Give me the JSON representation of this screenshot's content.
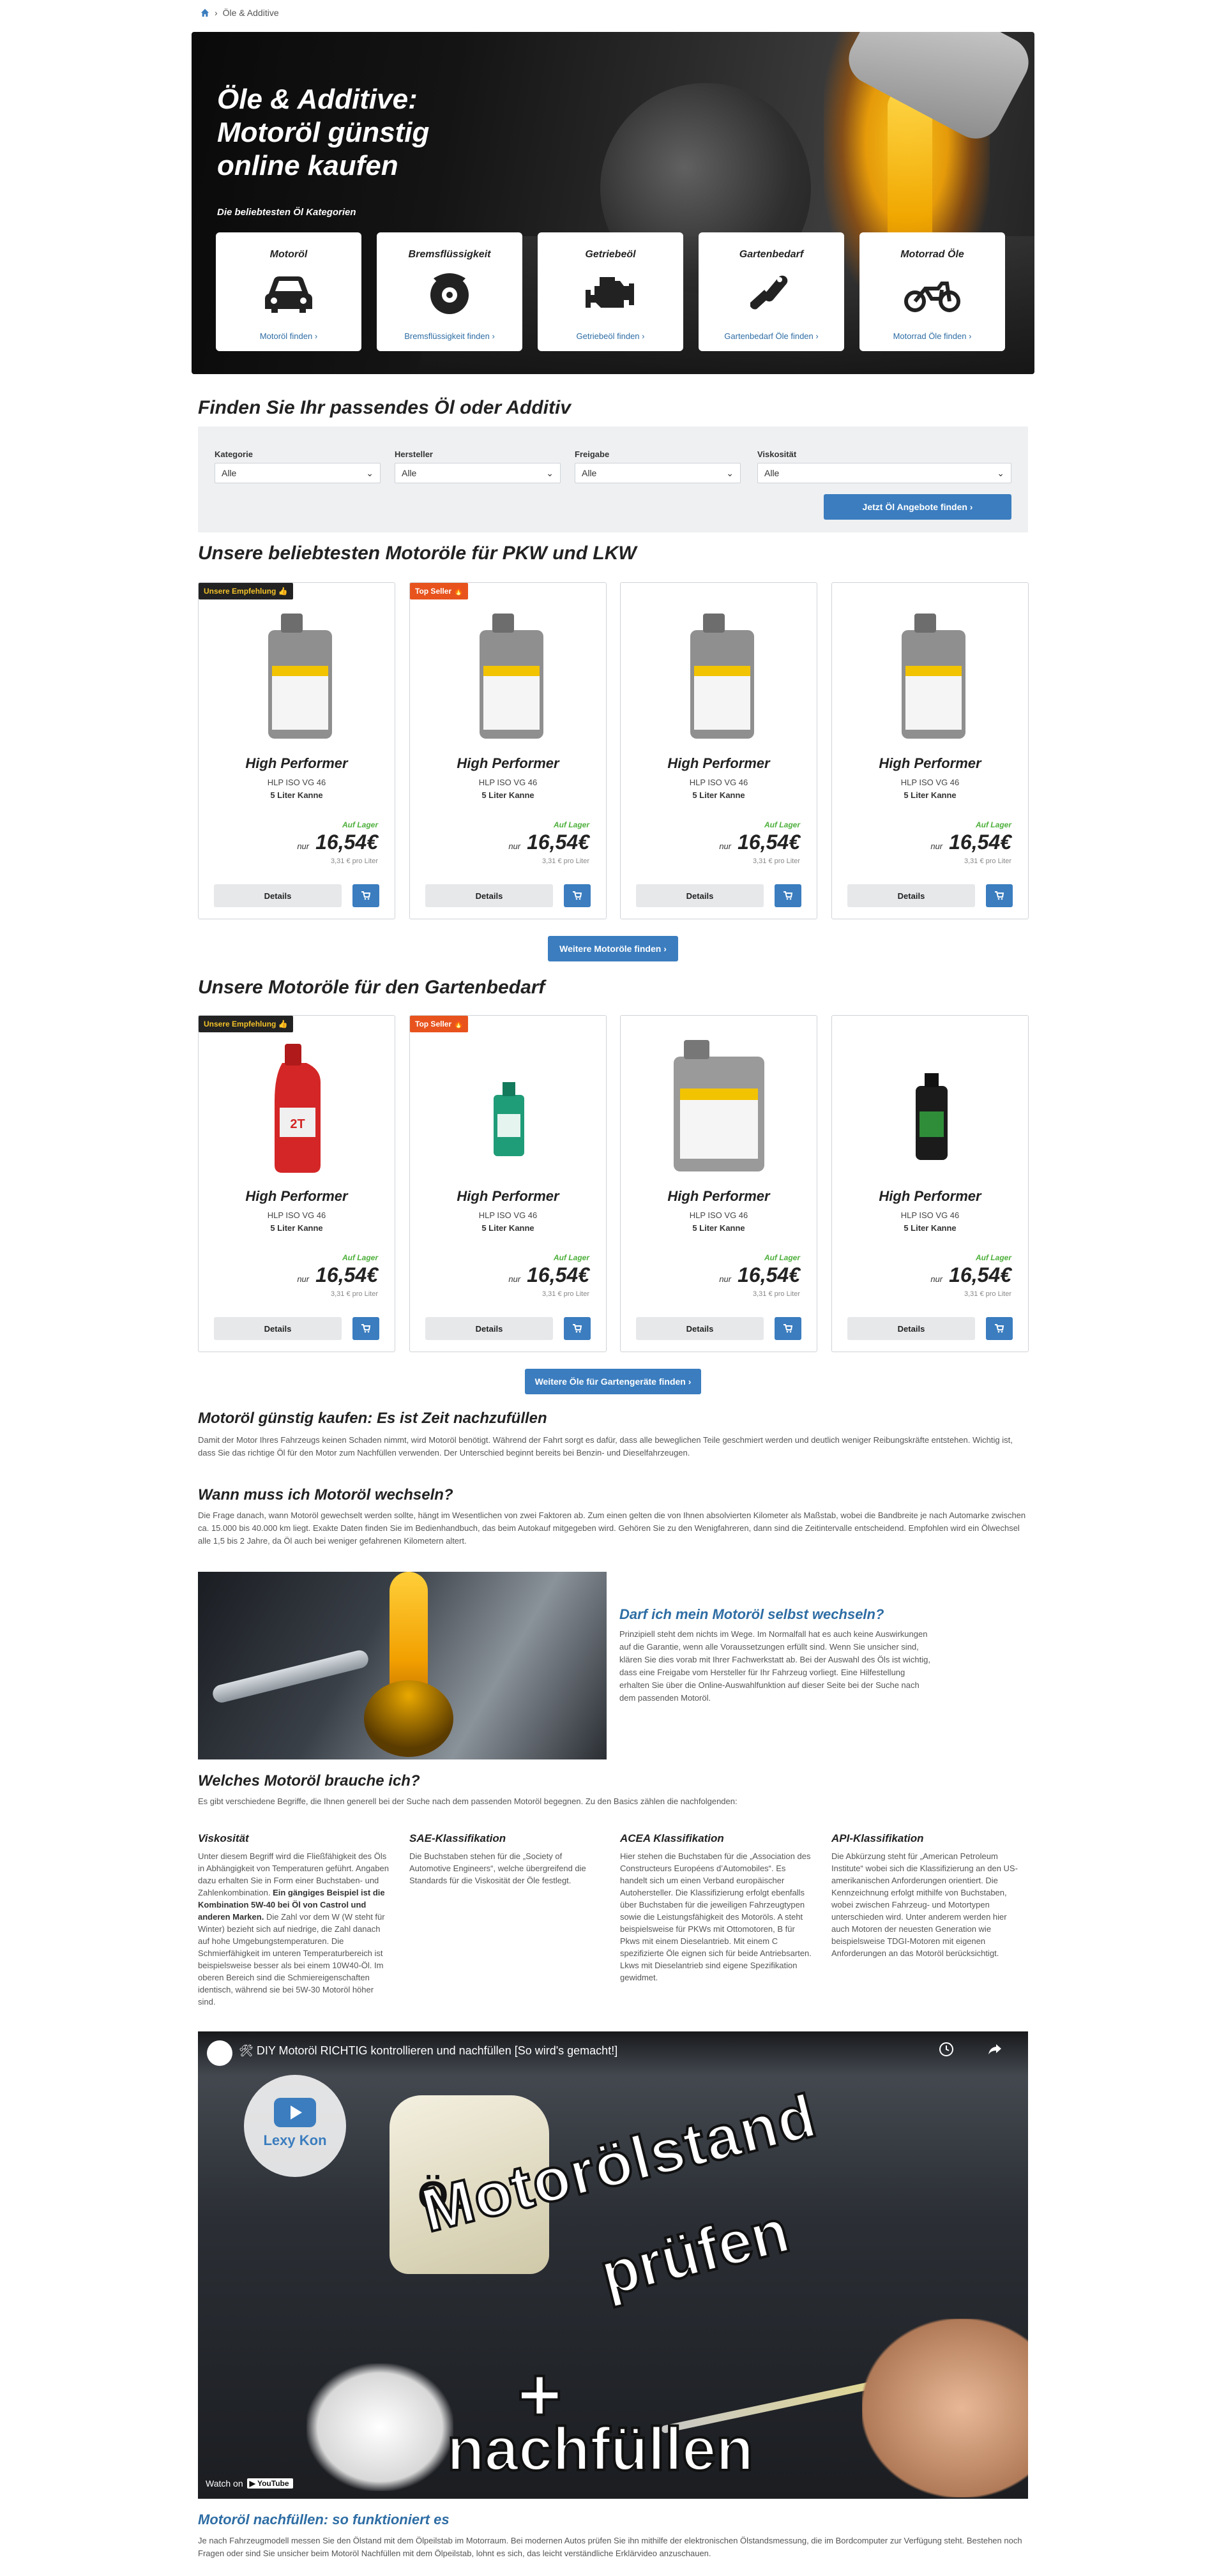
{
  "breadcrumb": {
    "current": "Öle & Additive"
  },
  "hero": {
    "title": "Öle & Additive: Motoröl günstig online kaufen",
    "subtitle": "Die beliebtesten Öl Kategorien",
    "categories": [
      {
        "title": "Motoröl",
        "icon": "car-icon",
        "link": "Motoröl finden"
      },
      {
        "title": "Bremsflüssigkeit",
        "icon": "brake-disc-icon",
        "link": "Bremsflüssigkeit finden"
      },
      {
        "title": "Getriebeöl",
        "icon": "engine-icon",
        "link": "Getriebeöl finden"
      },
      {
        "title": "Gartenbedarf",
        "icon": "chainsaw-icon",
        "link": "Gartenbedarf Öle finden"
      },
      {
        "title": "Motorrad Öle",
        "icon": "motorcycle-icon",
        "link": "Motorrad Öle finden"
      }
    ]
  },
  "finder": {
    "title": "Finden Sie Ihr passendes Öl oder Additiv",
    "fields": [
      {
        "label": "Kategorie",
        "value": "Alle"
      },
      {
        "label": "Hersteller",
        "value": "Alle"
      },
      {
        "label": "Freigabe",
        "value": "Alle"
      },
      {
        "label": "Viskosität",
        "value": "Alle"
      }
    ],
    "button": "Jetzt Öl Angebote finden"
  },
  "products_pkw": {
    "title": "Unsere beliebtesten Motoröle für PKW und LKW",
    "more": "Weitere Motoröle finden",
    "items": [
      {
        "badge": "Unsere Empfehlung 👍",
        "name": "High Performer",
        "spec": "HLP ISO VG 46",
        "size": "5 Liter Kanne",
        "stock": "Auf Lager",
        "nur": "nur",
        "price": "16,54€",
        "per_liter": "3,31 € pro Liter",
        "details": "Details"
      },
      {
        "badge": "Top Seller 🔥",
        "name": "High Performer",
        "spec": "HLP ISO VG 46",
        "size": "5 Liter Kanne",
        "stock": "Auf Lager",
        "nur": "nur",
        "price": "16,54€",
        "per_liter": "3,31 € pro Liter",
        "details": "Details"
      },
      {
        "badge": "",
        "name": "High Performer",
        "spec": "HLP ISO VG 46",
        "size": "5 Liter Kanne",
        "stock": "Auf Lager",
        "nur": "nur",
        "price": "16,54€",
        "per_liter": "3,31 € pro Liter",
        "details": "Details"
      },
      {
        "badge": "",
        "name": "High Performer",
        "spec": "HLP ISO VG 46",
        "size": "5 Liter Kanne",
        "stock": "Auf Lager",
        "nur": "nur",
        "price": "16,54€",
        "per_liter": "3,31 € pro Liter",
        "details": "Details"
      }
    ]
  },
  "products_garden": {
    "title": "Unsere Motoröle für den Gartenbedarf",
    "more": "Weitere Öle für Gartengeräte finden",
    "items": [
      {
        "badge": "Unsere Empfehlung 👍",
        "name": "High Performer",
        "spec": "HLP ISO VG 46",
        "size": "5 Liter Kanne",
        "stock": "Auf Lager",
        "nur": "nur",
        "price": "16,54€",
        "per_liter": "3,31 € pro Liter",
        "details": "Details"
      },
      {
        "badge": "Top Seller 🔥",
        "name": "High Performer",
        "spec": "HLP ISO VG 46",
        "size": "5 Liter Kanne",
        "stock": "Auf Lager",
        "nur": "nur",
        "price": "16,54€",
        "per_liter": "3,31 € pro Liter",
        "details": "Details"
      },
      {
        "badge": "",
        "name": "High Performer",
        "spec": "HLP ISO VG 46",
        "size": "5 Liter Kanne",
        "stock": "Auf Lager",
        "nur": "nur",
        "price": "16,54€",
        "per_liter": "3,31 € pro Liter",
        "details": "Details"
      },
      {
        "badge": "",
        "name": "High Performer",
        "spec": "HLP ISO VG 46",
        "size": "5 Liter Kanne",
        "stock": "Auf Lager",
        "nur": "nur",
        "price": "16,54€",
        "per_liter": "3,31 € pro Liter",
        "details": "Details"
      }
    ]
  },
  "article": {
    "h_buy": "Motoröl günstig kaufen: Es ist Zeit nachzufüllen",
    "p_buy": "Damit der Motor Ihres Fahrzeugs keinen Schaden nimmt, wird Motoröl benötigt. Während der Fahrt sorgt es dafür, dass alle beweglichen Teile geschmiert werden und deutlich weniger Reibungskräfte entstehen. Wichtig ist, dass Sie das richtige Öl für den Motor zum Nachfüllen verwenden. Der Unterschied beginnt bereits bei Benzin- und Dieselfahrzeugen.",
    "h_when": "Wann muss ich Motoröl wechseln?",
    "p_when": "Die Frage danach, wann Motoröl gewechselt werden sollte, hängt im Wesentlichen von zwei Faktoren ab. Zum einen gelten die von Ihnen absolvierten Kilometer als Maßstab, wobei die Bandbreite je nach Automarke zwischen ca. 15.000 bis 40.000 km liegt. Exakte Daten finden Sie im Bedienhandbuch, das beim Autokauf mitgegeben wird. Gehören Sie zu den Wenigfahreren, dann sind die Zeitintervalle entscheidend. Empfohlen wird ein Ölwechsel alle 1,5 bis 2 Jahre, da Öl auch bei weniger gefahrenen Kilometern altert.",
    "h_self": "Darf ich mein Motoröl selbst wechseln?",
    "p_self": "Prinzipiell steht dem nichts im Wege. Im Normalfall hat es auch keine Auswirkungen auf die Garantie, wenn alle Voraussetzungen erfüllt sind. Wenn Sie unsicher sind, klären Sie dies vorab mit Ihrer Fachwerkstatt ab. Bei der Auswahl des Öls ist wichtig, dass eine Freigabe vom Hersteller für Ihr Fahrzeug vorliegt. Eine Hilfestellung erhalten Sie über die Online-Auswahlfunktion auf dieser Seite bei der Suche nach dem passenden Motoröl.",
    "h_which": "Welches Motoröl brauche ich?",
    "p_which": "Es gibt verschiedene Begriffe, die Ihnen generell bei der Suche nach dem passenden Motoröl begegnen. Zu den Basics zählen die nachfolgenden:",
    "columns": [
      {
        "title": "Viskosität",
        "text_a": "Unter diesem Begriff wird die Fließfähigkeit des Öls in Abhängigkeit von Temperaturen geführt. Angaben dazu erhalten Sie in Form einer Buchstaben- und Zahlenkombination. ",
        "text_b": "Ein gängiges Beispiel ist die Kombination 5W-40 bei Öl von Castrol und anderen Marken.",
        "text_c": " Die Zahl vor dem W (W steht für Winter) bezieht sich auf niedrige, die Zahl danach auf hohe Umgebungstemperaturen. Die Schmierfähigkeit im unteren Temperaturbereich ist beispielsweise besser als bei einem 10W40-Öl. Im oberen Bereich sind die Schmiereigenschaften identisch, während sie bei 5W-30 Motoröl höher sind."
      },
      {
        "title": "SAE-Klassifikation",
        "text_a": "Die Buchstaben stehen für die „Society of Automotive Engineers“, welche übergreifend die Standards für die Viskosität der Öle festlegt.",
        "text_b": "",
        "text_c": ""
      },
      {
        "title": "ACEA Klassifikation",
        "text_a": "Hier stehen die Buchstaben für die „Association des Constructeurs Européens d’Automobiles“. Es handelt sich um einen Verband europäischer Autohersteller. Die Klassifizierung erfolgt ebenfalls über Buchstaben für die jeweiligen Fahrzeugtypen sowie die Leistungsfähigkeit des Motoröls. A steht beispielsweise für PKWs mit Ottomotoren, B für Pkws mit einem Dieselantrieb. Mit einem C spezifizierte Öle eignen sich für beide Antriebsarten. Lkws mit Dieselantrieb sind eigene Spezifikation gewidmet.",
        "text_b": "",
        "text_c": ""
      },
      {
        "title": "API-Klassifikation",
        "text_a": "Die Abkürzung steht für „American Petroleum Institute“ wobei sich die Klassifizierung an den US-amerikanischen Anforderungen orientiert. Die Kennzeichnung erfolgt mithilfe von Buchstaben, wobei zwischen Fahrzeug- und Motortypen unterschieden wird. Unter anderem werden hier auch Motoren der neuesten Generation wie beispielsweise TDGI-Motoren mit eigenen Anforderungen an das Motoröl berücksichtigt.",
        "text_b": "",
        "text_c": ""
      }
    ],
    "video": {
      "title": "🛠 DIY Motoröl RICHTIG kontrollieren und nachfüllen [So wird's gemacht!]",
      "channel": "Lexy Kon",
      "overlay_can": "ÖL",
      "overlay_1": "Motorölstand",
      "overlay_2": "prüfen",
      "overlay_plus": "+",
      "overlay_3": "nachfüllen",
      "watch_on": "Watch on",
      "youtube": "YouTube"
    },
    "h_refill": "Motoröl nachfüllen: so funktioniert es",
    "p_refill": "Je nach Fahrzeugmodell messen Sie den Ölstand mit dem Ölpeilstab im Motorraum. Bei modernen Autos prüfen Sie ihn mithilfe der elektronischen Ölstandsmessung, die im Bordcomputer zur Verfügung steht. Bestehen noch Fragen oder sind Sie unsicher beim Motoröl Nachfüllen mit dem Ölpeilstab, lohnt es sich, das leicht verständliche Erklärvideo anzuschauen."
  },
  "colors": {
    "accent": "#3b7dbf",
    "link": "#2e6da4",
    "stock": "#4caf3a",
    "top_seller": "#e8531d",
    "recommend_text": "#f3c128"
  }
}
